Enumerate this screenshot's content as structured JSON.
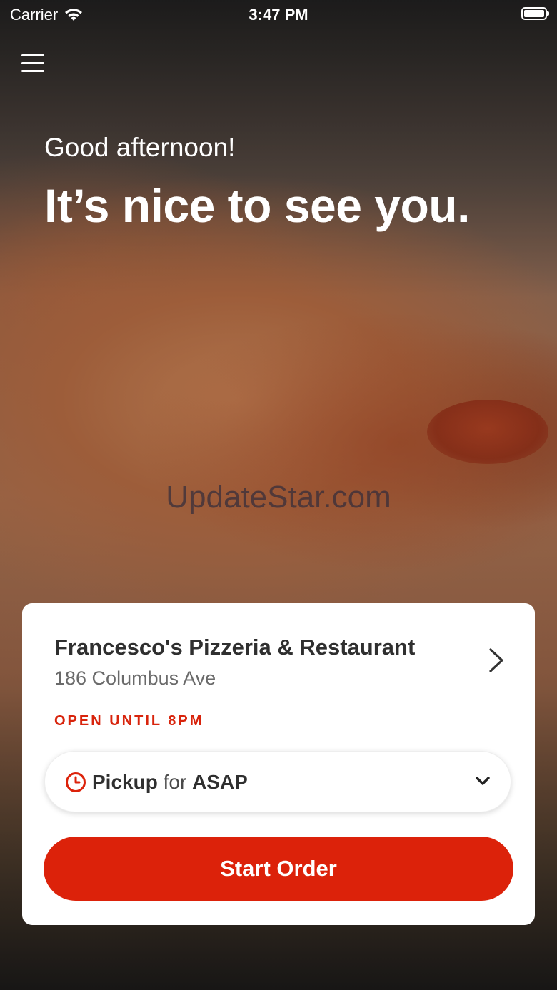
{
  "status_bar": {
    "carrier": "Carrier",
    "time": "3:47 PM"
  },
  "hero": {
    "greeting": "Good afternoon!",
    "headline": "It’s nice to see you.",
    "watermark": "UpdateStar.com"
  },
  "restaurant": {
    "name": "Francesco's Pizzeria & Restaurant",
    "address": "186 Columbus Ave",
    "hours": "OPEN UNTIL 8PM"
  },
  "order_type": {
    "mode": "Pickup",
    "connector": "for",
    "time": "ASAP"
  },
  "cta": {
    "label": "Start Order"
  },
  "colors": {
    "accent": "#dc220a",
    "text_dark": "#2f2f2f",
    "text_muted": "#6a6a6a"
  },
  "icons": [
    "wifi-icon",
    "battery-icon",
    "menu-icon",
    "chevron-right-icon",
    "clock-icon",
    "chevron-down-icon"
  ]
}
